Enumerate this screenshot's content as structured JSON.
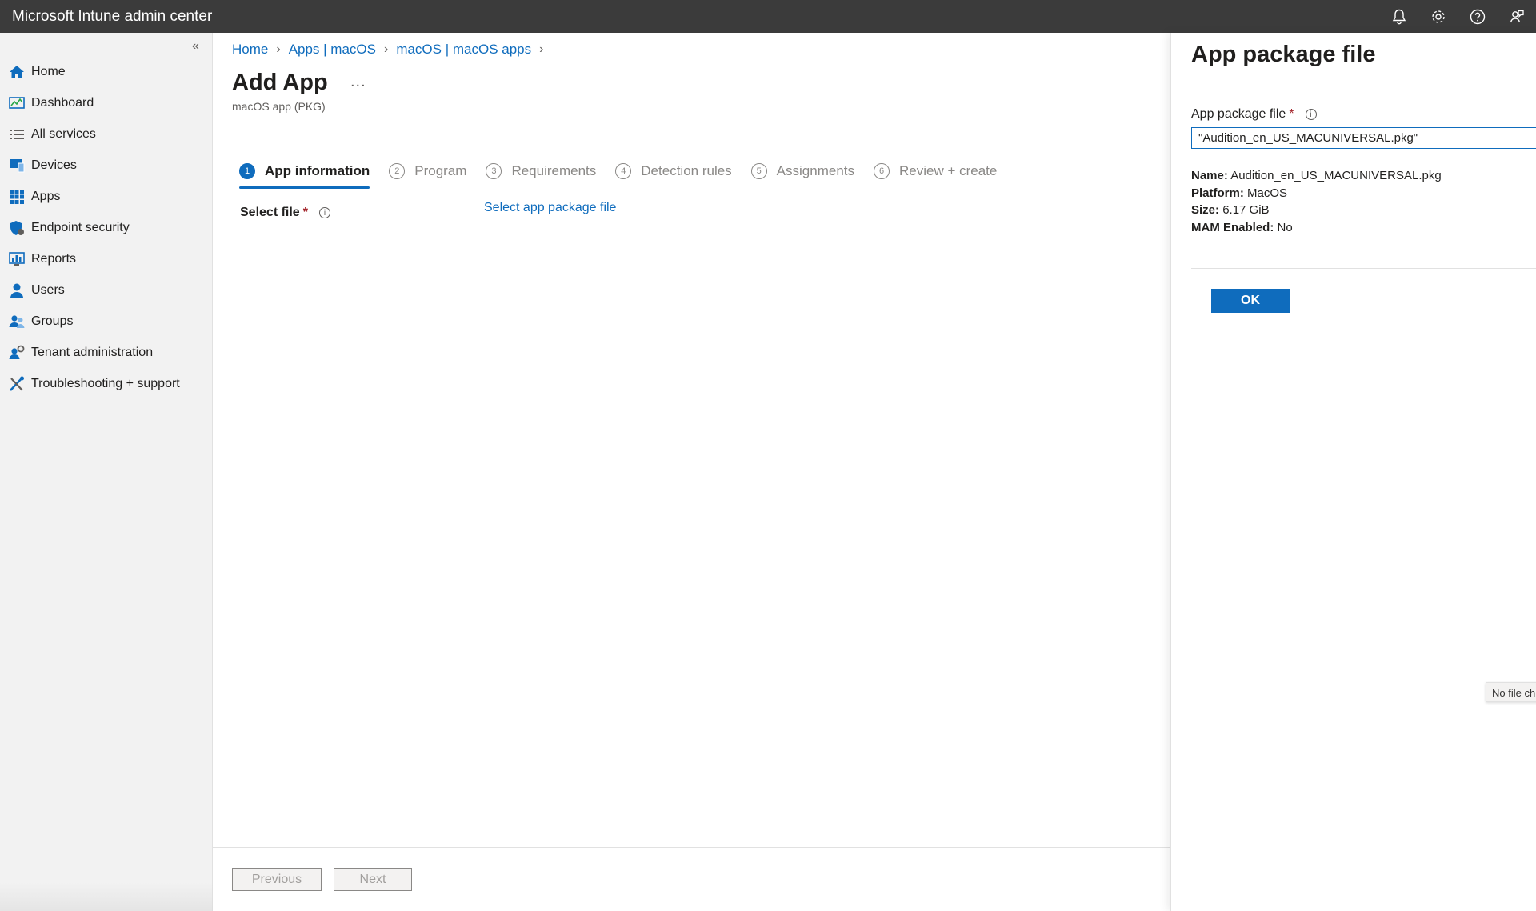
{
  "app": {
    "title": "Microsoft Intune admin center"
  },
  "topbar": {
    "icons": [
      "bell-icon",
      "gear-icon",
      "help-icon",
      "feedback-icon"
    ]
  },
  "sidebar": {
    "collapse_glyph": "«",
    "items": [
      {
        "label": "Home",
        "icon": "home-icon"
      },
      {
        "label": "Dashboard",
        "icon": "dashboard-icon"
      },
      {
        "label": "All services",
        "icon": "list-icon"
      },
      {
        "label": "Devices",
        "icon": "devices-icon"
      },
      {
        "label": "Apps",
        "icon": "apps-icon"
      },
      {
        "label": "Endpoint security",
        "icon": "shield-icon"
      },
      {
        "label": "Reports",
        "icon": "reports-icon"
      },
      {
        "label": "Users",
        "icon": "user-icon"
      },
      {
        "label": "Groups",
        "icon": "groups-icon"
      },
      {
        "label": "Tenant administration",
        "icon": "tenant-icon"
      },
      {
        "label": "Troubleshooting + support",
        "icon": "tools-icon"
      }
    ]
  },
  "breadcrumb": [
    "Home",
    "Apps | macOS",
    "macOS | macOS apps"
  ],
  "page": {
    "title": "Add App",
    "more": "...",
    "subtitle": "macOS app (PKG)"
  },
  "steps": [
    {
      "num": "1",
      "label": "App information",
      "active": true
    },
    {
      "num": "2",
      "label": "Program"
    },
    {
      "num": "3",
      "label": "Requirements"
    },
    {
      "num": "4",
      "label": "Detection rules"
    },
    {
      "num": "5",
      "label": "Assignments"
    },
    {
      "num": "6",
      "label": "Review + create"
    }
  ],
  "form": {
    "select_file_label": "Select file",
    "required_mark": "*",
    "select_link": "Select app package file"
  },
  "footer": {
    "previous": "Previous",
    "next": "Next"
  },
  "panel": {
    "title": "App package file",
    "field_label": "App package file",
    "required_mark": "*",
    "input_value": "\"Audition_en_US_MACUNIVERSAL.pkg\"",
    "details": {
      "name_label": "Name:",
      "name_value": "Audition_en_US_MACUNIVERSAL.pkg",
      "platform_label": "Platform:",
      "platform_value": "MacOS",
      "size_label": "Size:",
      "size_value": "6.17 GiB",
      "mam_label": "MAM Enabled:",
      "mam_value": "No"
    },
    "ok": "OK",
    "tooltip": "No file ch"
  },
  "colors": {
    "accent": "#0f6cbd",
    "topbar": "#3b3b3b",
    "sidebar": "#f2f2f2"
  }
}
